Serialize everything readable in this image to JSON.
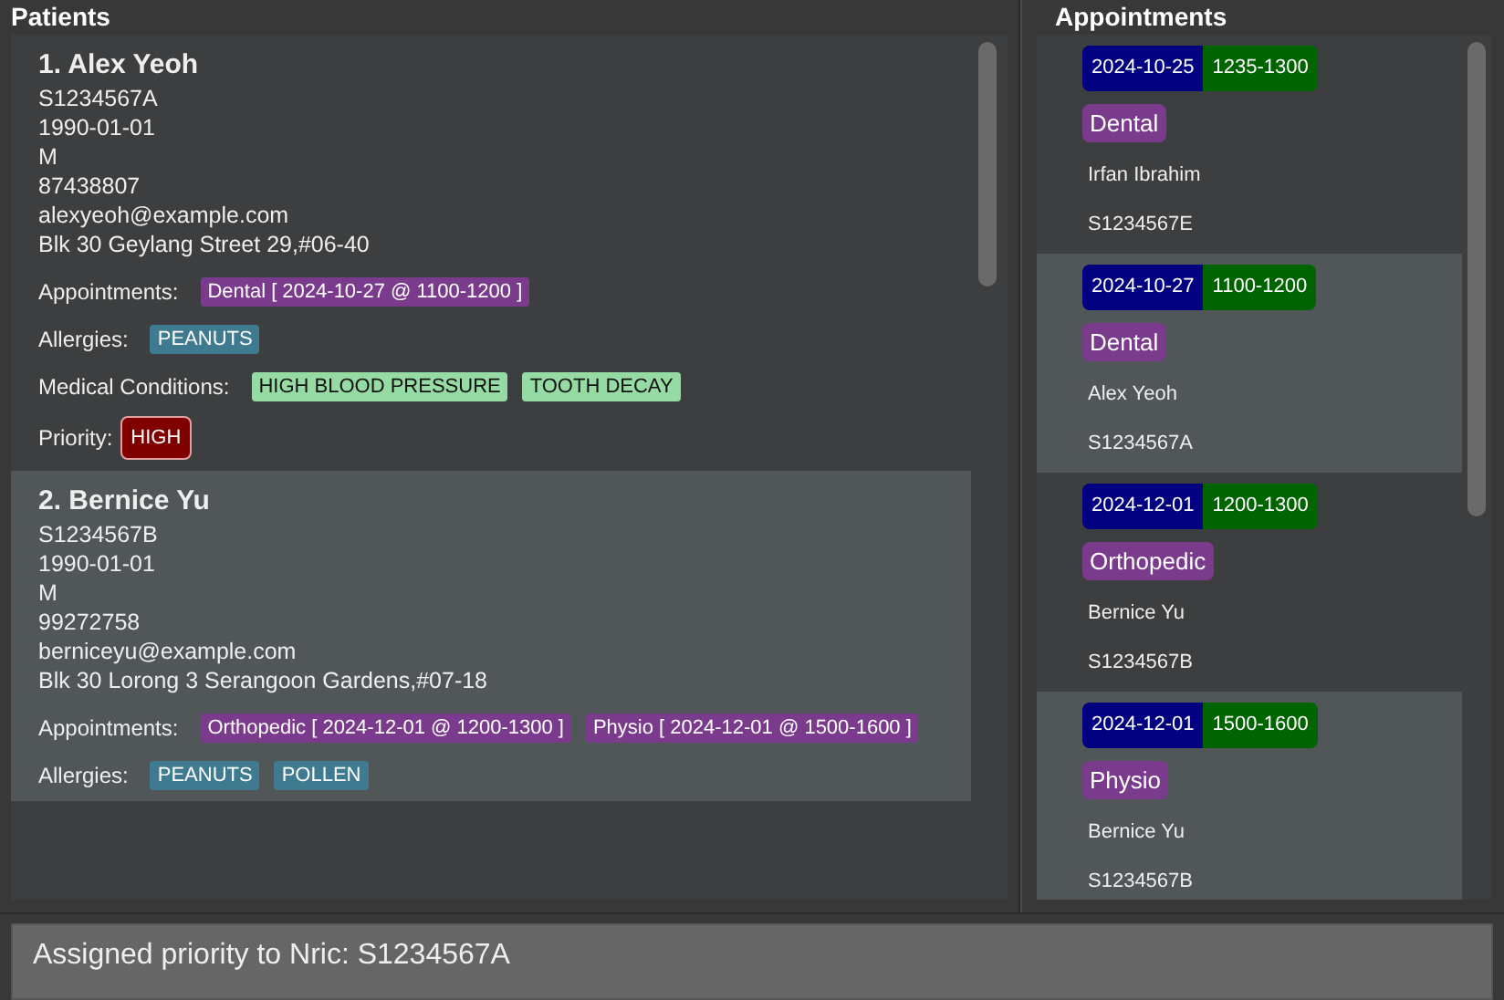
{
  "patients_panel": {
    "title": "Patients",
    "patients": [
      {
        "index": "1.",
        "name": "Alex Yeoh",
        "nric": "S1234567A",
        "dob": "1990-01-01",
        "sex": "M",
        "phone": "87438807",
        "email": "alexyeoh@example.com",
        "address": "Blk 30 Geylang Street 29,#06-40",
        "appointments_label": "Appointments:",
        "appointments": [
          "Dental [ 2024-10-27 @ 1100-1200 ]"
        ],
        "allergies_label": "Allergies:",
        "allergies": [
          "PEANUTS"
        ],
        "conditions_label": "Medical Conditions:",
        "conditions": [
          "HIGH BLOOD PRESSURE",
          "TOOTH DECAY"
        ],
        "priority_label": "Priority:",
        "priority": {
          "label": "HIGH",
          "kind": "high"
        }
      },
      {
        "index": "2.",
        "name": "Bernice Yu",
        "nric": "S1234567B",
        "dob": "1990-01-01",
        "sex": "M",
        "phone": "99272758",
        "email": "berniceyu@example.com",
        "address": "Blk 30 Lorong 3 Serangoon Gardens,#07-18",
        "appointments_label": "Appointments:",
        "appointments": [
          "Orthopedic [ 2024-12-01 @ 1200-1300 ]",
          "Physio [ 2024-12-01 @ 1500-1600 ]"
        ],
        "allergies_label": "Allergies:",
        "allergies": [
          "PEANUTS",
          "POLLEN"
        ]
      }
    ]
  },
  "appointments_panel": {
    "title": "Appointments",
    "appointments": [
      {
        "date": "2024-10-25",
        "time": "1235-1300",
        "type": "Dental",
        "patient": "Irfan Ibrahim",
        "nric": "S1234567E"
      },
      {
        "date": "2024-10-27",
        "time": "1100-1200",
        "type": "Dental",
        "patient": "Alex Yeoh",
        "nric": "S1234567A"
      },
      {
        "date": "2024-12-01",
        "time": "1200-1300",
        "type": "Orthopedic",
        "patient": "Bernice Yu",
        "nric": "S1234567B"
      },
      {
        "date": "2024-12-01",
        "time": "1500-1600",
        "type": "Physio",
        "patient": "Bernice Yu",
        "nric": "S1234567B"
      }
    ]
  },
  "result_display": {
    "message": "Assigned priority to Nric: S1234567A"
  }
}
